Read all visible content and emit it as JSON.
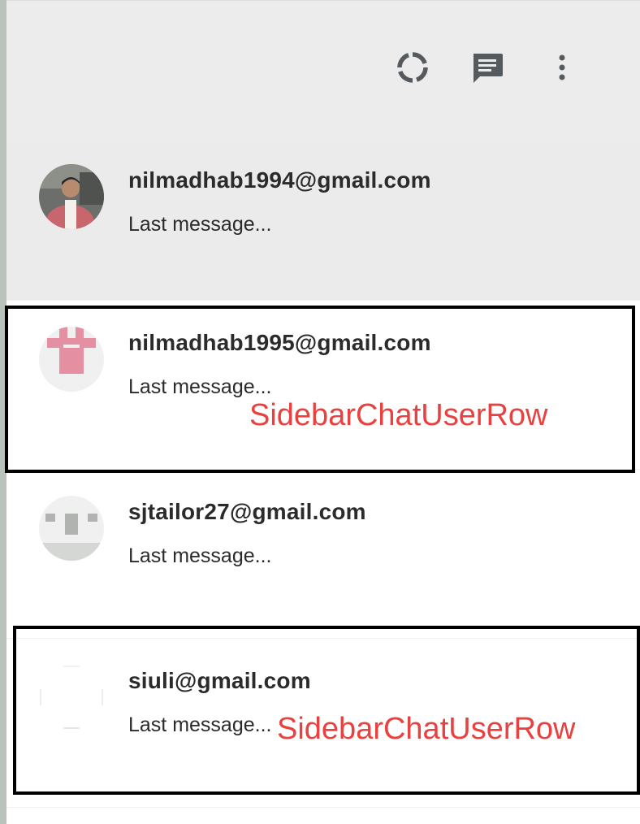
{
  "header": {
    "icons": [
      {
        "name": "status-icon",
        "label": "Status"
      },
      {
        "name": "new-chat-icon",
        "label": "New chat"
      },
      {
        "name": "more-vert-icon",
        "label": "Menu"
      }
    ]
  },
  "chats": [
    {
      "email": "nilmadhab1994@gmail.com",
      "last_message": "Last message...",
      "avatar": "photo"
    },
    {
      "email": "nilmadhab1995@gmail.com",
      "last_message": "Last message...",
      "avatar": "identicon-pink"
    },
    {
      "email": "sjtailor27@gmail.com",
      "last_message": "Last message...",
      "avatar": "identicon-gray"
    },
    {
      "email": "siuli@gmail.com",
      "last_message": "Last message...",
      "avatar": "identicon-light"
    }
  ],
  "annotations": {
    "label_1": "SidebarChatUserRow",
    "label_2": "SidebarChatUserRow",
    "color": "#e8413f"
  },
  "colors": {
    "header_bg": "#ececec",
    "active_row_bg": "#ebebeb",
    "icon": "#545a5e"
  }
}
